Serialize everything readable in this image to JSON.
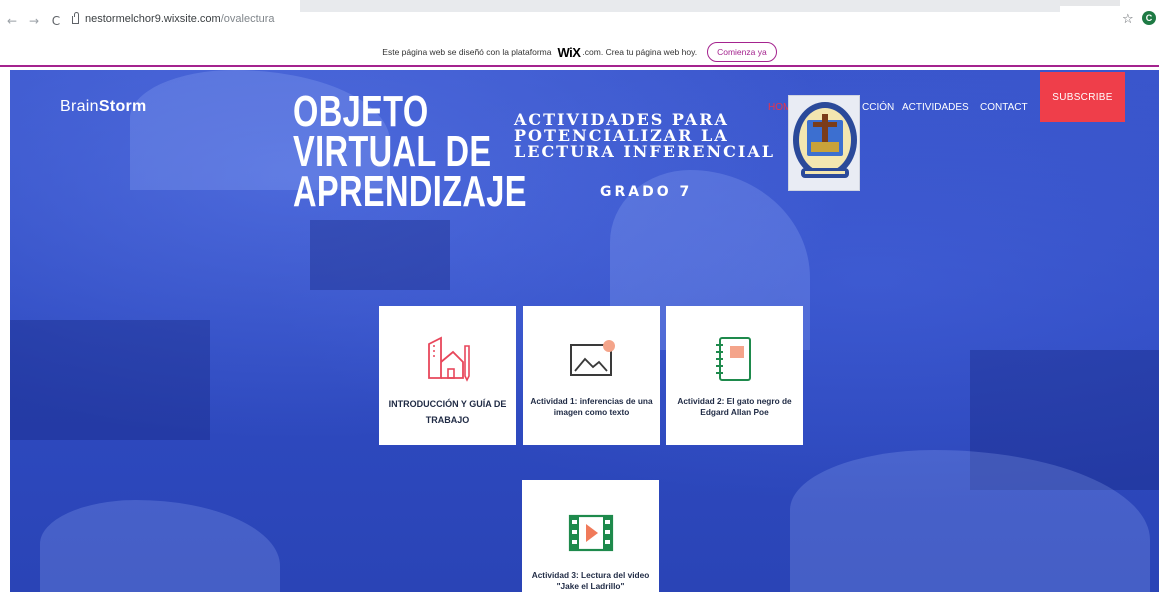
{
  "browser": {
    "url_host": "nestormelchor9.wixsite.com",
    "url_path": "/ovalectura",
    "profile_initial": "C",
    "nav_back": "←",
    "nav_forward": "→",
    "nav_reload": "C",
    "star": "☆"
  },
  "wix_banner": {
    "text": "Este página web se diseñó con la plataforma",
    "logo": "WiX",
    "dotcom": ".com. Crea tu página web hoy.",
    "cta": "Comienza ya"
  },
  "site": {
    "brand_light": "Brain",
    "brand_bold": "Storm",
    "title_lines": [
      "OBJETO",
      "VIRTUAL DE",
      "APRENDIZAJE"
    ],
    "subtitle_lines": [
      "ACTIVIDADES PARA",
      "POTENCIALIZAR LA",
      "LECTURA INFERENCIAL"
    ],
    "grade": "GRADO 7",
    "nav": {
      "home": "HOME",
      "intro": "CCIÓN",
      "activities": "ACTIVIDADES",
      "contact": "CONTACT",
      "subscribe": "SUBSCRIBE"
    }
  },
  "cards": [
    {
      "label": "INTRODUCCIÓN Y GUÍA DE TRABAJO",
      "icon": "house-pencil-icon"
    },
    {
      "label": "Actividad 1: inferencias de una imagen como texto",
      "icon": "image-icon"
    },
    {
      "label": "Actividad 2: El gato negro de Edgard Allan Poe",
      "icon": "notebook-icon"
    },
    {
      "label": "Actividad 3: Lectura del video \"Jake el Ladrillo\"",
      "icon": "video-film-icon"
    }
  ],
  "colors": {
    "accent": "#ef3e4a",
    "icon_red": "#e8475b",
    "icon_green": "#1e8a4c",
    "icon_dark": "#3a3a3a",
    "hero_blue": "#2f4bc2",
    "wix_purple": "#a4238e"
  }
}
